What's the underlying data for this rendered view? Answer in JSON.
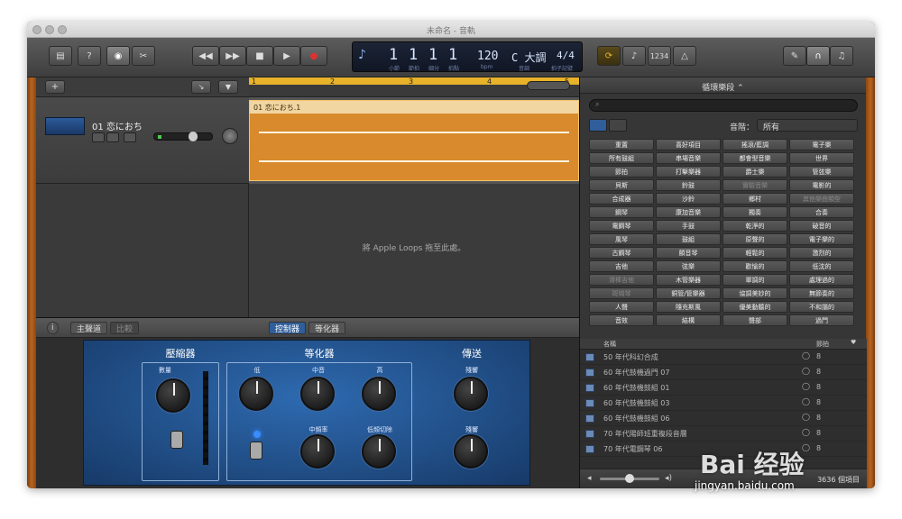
{
  "window": {
    "title": "未命名 - 音軌"
  },
  "toolbar": {
    "library_label": "",
    "help_label": "?",
    "rewind": "◀◀",
    "forward": "▶▶",
    "stop": "■",
    "play": "▶",
    "record": "●",
    "count_in": "1234"
  },
  "lcd": {
    "bar": "1",
    "beat": "1",
    "div": "1",
    "tick": "1",
    "bar_lbl": "小節",
    "beat_lbl": "節拍",
    "div_lbl": "細分",
    "tick_lbl": "拍點",
    "tempo": "120",
    "tempo_lbl": "bpm",
    "key": "C 大調",
    "key_lbl": "音調",
    "sig": "4/4",
    "sig_lbl": "拍子記號"
  },
  "tracks": {
    "add_label": "+",
    "track_name": "01 恋におち",
    "region_name": "01 恋におち.1",
    "ruler": [
      "1",
      "2",
      "3",
      "4",
      "5"
    ],
    "drop_message": "將 Apple Loops 拖至此處。"
  },
  "editor": {
    "tab_master": "主聲道",
    "tab_compare": "比較",
    "tab_controls": "控制器",
    "tab_eq": "等化器",
    "compressor": "壓縮器",
    "eq": "等化器",
    "sends": "傳送",
    "amount": "數量",
    "low": "低",
    "mid": "中音",
    "high": "高",
    "mid_freq": "中頻率",
    "low_cut": "低頻切除",
    "echo": "殘響",
    "reverb": "殘響"
  },
  "loops": {
    "title": "循環樂段",
    "scale_label": "音階：",
    "scale_value": "所有",
    "keywords": [
      [
        "重置",
        "喜好項目",
        "搖滾/藍調",
        "電子樂"
      ],
      [
        "所有鼓組",
        "串場音樂",
        "都會型音樂",
        "世界"
      ],
      [
        "節拍",
        "打擊樂器",
        "爵士樂",
        "管弦樂"
      ],
      [
        "貝斯",
        "鈴鼓",
        "實驗音樂",
        "電影的"
      ],
      [
        "合成器",
        "沙鈴",
        "鄉村",
        "其他樂曲類型"
      ],
      [
        "鋼琴",
        "康加音樂",
        "獨奏",
        "合奏"
      ],
      [
        "電鋼琴",
        "手鼓",
        "乾淨的",
        "破音的"
      ],
      [
        "風琴",
        "鼓組",
        "原聲的",
        "電子樂的"
      ],
      [
        "古鋼琴",
        "顫音琴",
        "輕鬆的",
        "激烈的"
      ],
      [
        "吉他",
        "弦樂",
        "歡愉的",
        "低沈的"
      ],
      [
        "滑棒吉他",
        "木管樂器",
        "單調的",
        "處理過的"
      ],
      [
        "斑鳩琴",
        "銅管/管樂器",
        "協調美妙的",
        "無節奏的"
      ],
      [
        "人聲",
        "隨充斯風",
        "優美動聽的",
        "不和諧的"
      ],
      [
        "音效",
        "結構",
        "聲部",
        "過門"
      ]
    ],
    "dim_keywords": [
      "重置",
      "喜好項目",
      "實驗音樂",
      "其他樂曲類型",
      "滑棒吉他",
      "斑鳩琴"
    ],
    "col_name": "名稱",
    "col_beats": "節拍",
    "results": [
      {
        "name": "50 年代科幻合成",
        "beats": "8"
      },
      {
        "name": "60 年代鼓機過門 07",
        "beats": "8"
      },
      {
        "name": "60 年代鼓機鼓組 01",
        "beats": "8"
      },
      {
        "name": "60 年代鼓機鼓組 03",
        "beats": "8"
      },
      {
        "name": "60 年代鼓機鼓組 06",
        "beats": "8"
      },
      {
        "name": "70 年代陽師班重複段音層",
        "beats": "8"
      },
      {
        "name": "70 年代電鋼琴 06",
        "beats": "8"
      }
    ],
    "count": "3636 個項目"
  },
  "watermark": {
    "logo": "Bai 经验",
    "url": "jingyan.baidu.com"
  },
  "colors": {
    "accent": "#d88a2c",
    "region": "#f2d6a2",
    "amp": "#2e6ab0"
  }
}
